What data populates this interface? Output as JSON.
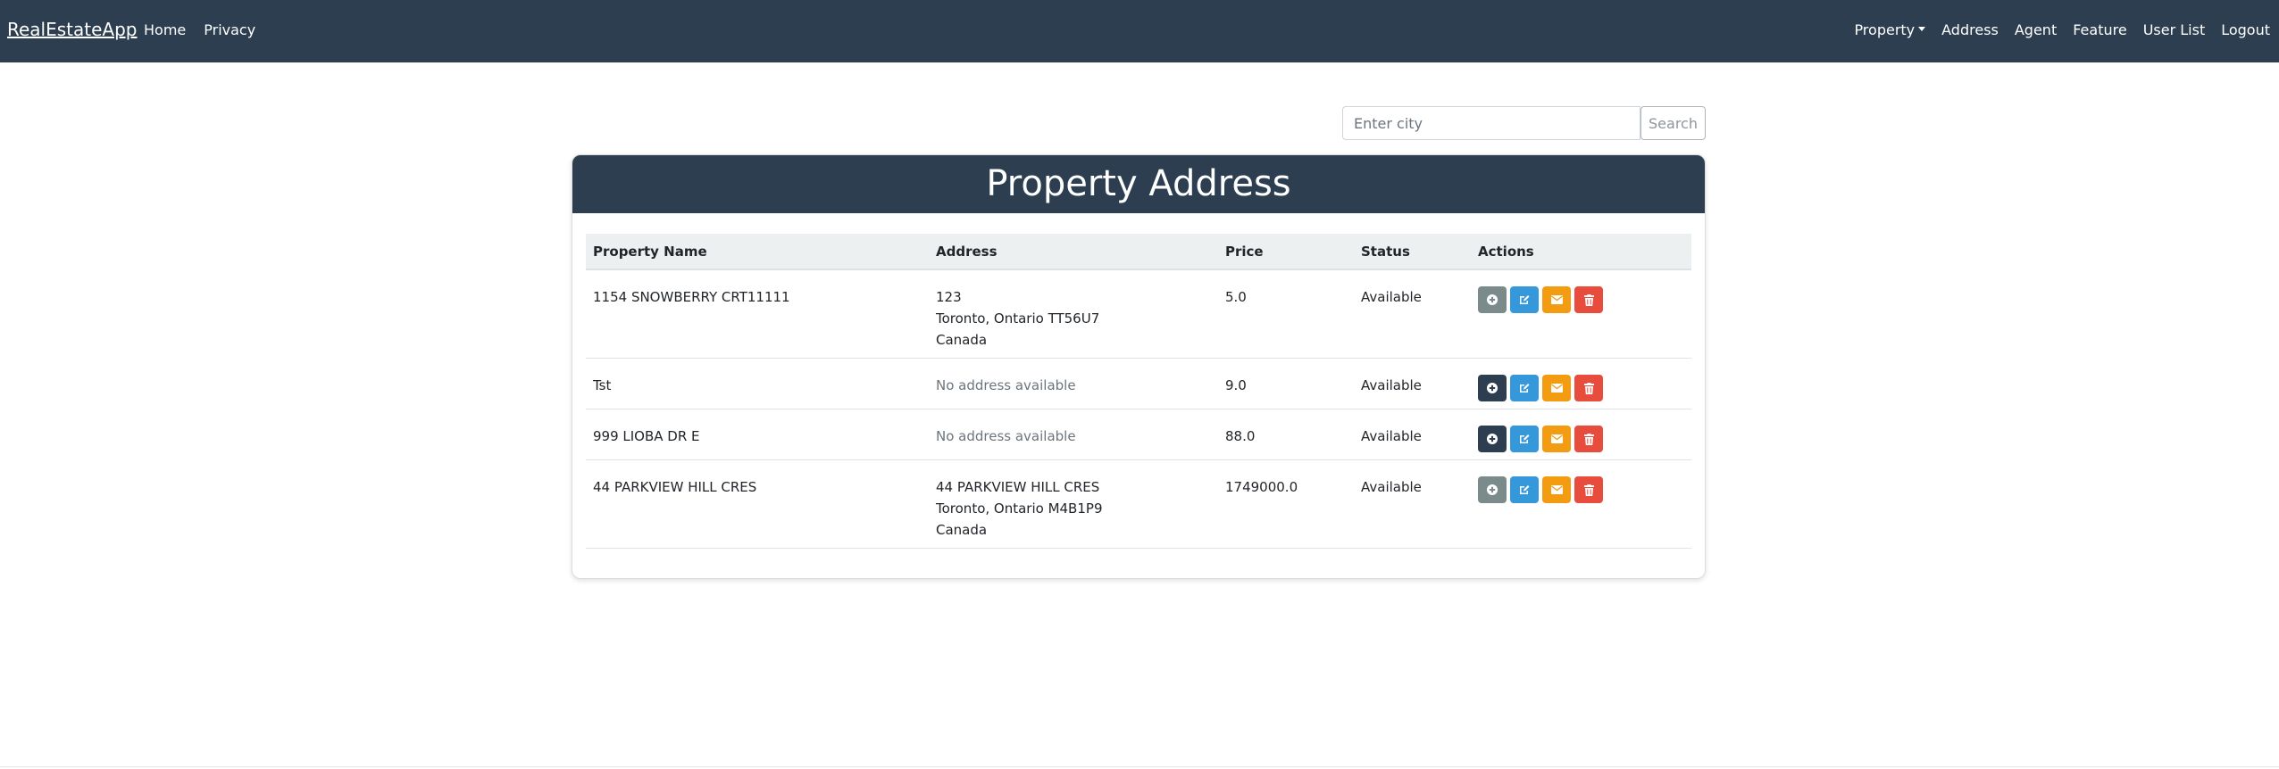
{
  "navbar": {
    "brand": "RealEstateApp",
    "left_links": [
      "Home",
      "Privacy"
    ],
    "right_links": {
      "property": "Property",
      "address": "Address",
      "agent": "Agent",
      "feature": "Feature",
      "user_list": "User List",
      "logout": "Logout"
    }
  },
  "search": {
    "placeholder": "Enter city",
    "value": "",
    "button_label": "Search"
  },
  "card": {
    "title": "Property Address"
  },
  "table": {
    "headers": [
      "Property Name",
      "Address",
      "Price",
      "Status",
      "Actions"
    ],
    "rows": [
      {
        "name": "1154 SNOWBERRY CRT11111",
        "address_line1": "123",
        "address_line2": "Toronto, Ontario TT56U7",
        "address_line3": "Canada",
        "price": "5.0",
        "status": "Available",
        "add_variant": "grey"
      },
      {
        "name": "Tst",
        "address_empty": "No address available",
        "price": "9.0",
        "status": "Available",
        "add_variant": "dark"
      },
      {
        "name": "999 LIOBA DR E",
        "address_empty": "No address available",
        "price": "88.0",
        "status": "Available",
        "add_variant": "dark"
      },
      {
        "name": "44 PARKVIEW HILL CRES",
        "address_line1": "44 PARKVIEW HILL CRES",
        "address_line2": "Toronto, Ontario M4B1P9",
        "address_line3": "Canada",
        "price": "1749000.0",
        "status": "Available",
        "add_variant": "grey"
      }
    ]
  },
  "colors": {
    "navbar": "#2c3e50",
    "add_grey": "#7b8a8b",
    "add_dark": "#2c3e50",
    "edit": "#3498db",
    "email": "#f39c12",
    "delete": "#e74c3c"
  },
  "icons": {
    "add": "plus-circle-icon",
    "edit": "edit-icon",
    "email": "envelope-icon",
    "delete": "trash-icon",
    "dropdown": "caret-down-icon"
  }
}
